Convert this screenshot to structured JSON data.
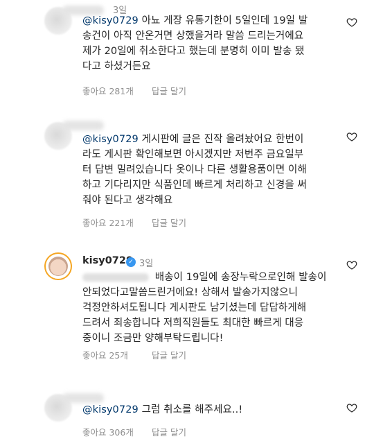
{
  "comments": [
    {
      "time": "3일",
      "mention": "@kisy0729",
      "lines": [
        " 아뇨 게장 유통기한이 5일인데 19일 발",
        "송건이 아직 안온거면 상했을거라 말씀 드리는거에요",
        "제가 20일에 취소한다고 했는데 분명히 이미 발송 됐",
        "다고 하셨거든요"
      ],
      "likes": "좋아요 281개",
      "reply": "답글 달기"
    },
    {
      "mention": "@kisy0729",
      "lines": [
        " 게시판에 글은 진작 올려놨어요 한번이",
        "라도 게시판 확인해보면 아시겠지만 저번주 금요일부",
        "터 답변 밀려있습니다 옷이나 다른 생활용품이면 이해",
        "하고 기다리지만 식품인데 빠르게 처리하고 신경을 써",
        "줘야 된다고 생각해요"
      ],
      "likes": "좋아요 221개",
      "reply": "답글 달기"
    },
    {
      "username": "kisy0729",
      "time": "3일",
      "lines": [
        " 배송이 19일에 송장누락으로인해 발송이",
        "안되었다고말씀드린거에요! 상해서 발송가지않으니",
        "걱정안하셔도됩니다 게시판도 남기셨는데 답답하게해",
        "드려서 죄송합니다 저희직원들도 최대한 빠르게 대응",
        "중이니 조금만 양해부탁드립니다!"
      ],
      "likes": "좋아요 25개",
      "reply": "답글 달기"
    },
    {
      "mention": "@kisy0729",
      "lines": [
        " 그럼 취소를 해주세요..!"
      ],
      "likes": "좋아요 306개",
      "reply": "답글 달기"
    }
  ],
  "icons": {
    "like": "heart-outline-icon",
    "verified": "verified-badge-icon"
  },
  "colors": {
    "text": "#262626",
    "muted": "#8e8e8e",
    "mention": "#00376b",
    "verified": "#3897f0",
    "story_ring": "#f5a623"
  }
}
